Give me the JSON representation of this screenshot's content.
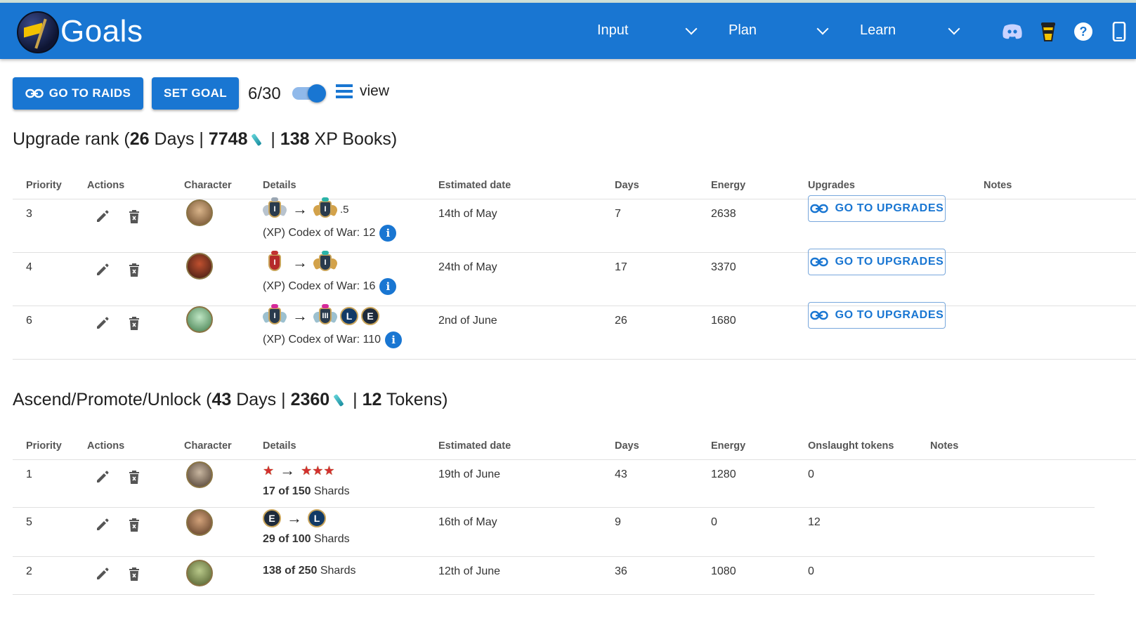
{
  "appbar": {
    "title": "Goals",
    "menus": [
      {
        "label": "Input"
      },
      {
        "label": "Plan"
      },
      {
        "label": "Learn"
      }
    ],
    "icons": [
      "discord-icon",
      "coffee-cup-icon",
      "help-icon",
      "mobile-icon"
    ]
  },
  "toolbar": {
    "raids_label": "GO TO RAIDS",
    "set_goal_label": "SET GOAL",
    "goal_count": "6/30",
    "view_label": "view",
    "view_toggle_on": true
  },
  "upgrade_section": {
    "prefix": "Upgrade rank (",
    "days": "26",
    "days_label": " Days | ",
    "energy": "7748",
    "sep": " | ",
    "books": "138",
    "books_label": " XP Books)",
    "columns": [
      "Priority",
      "Actions",
      "Character",
      "Details",
      "Estimated date",
      "Days",
      "Energy",
      "Upgrades",
      "Notes"
    ],
    "button_label": "GO TO UPGRADES",
    "rows": [
      {
        "priority": "3",
        "rank_suffix": ".5",
        "codex": "(XP) Codex of War: 12",
        "date": "14th of May",
        "days": "7",
        "energy": "2638"
      },
      {
        "priority": "4",
        "rank_suffix": "",
        "codex": "(XP) Codex of War: 16",
        "date": "24th of May",
        "days": "17",
        "energy": "3370"
      },
      {
        "priority": "6",
        "rank_suffix": "",
        "codex": "(XP) Codex of War: 110",
        "date": "2nd of June",
        "days": "26",
        "energy": "1680",
        "rarity_from": "L",
        "rarity_to": "E"
      }
    ]
  },
  "ascend_section": {
    "prefix": "Ascend/Promote/Unlock (",
    "days": "43",
    "days_label": " Days | ",
    "energy": "2360",
    "sep": " | ",
    "tokens": "12",
    "tokens_label": " Tokens)",
    "columns": [
      "Priority",
      "Actions",
      "Character",
      "Details",
      "Estimated date",
      "Days",
      "Energy",
      "Onslaught tokens",
      "Notes"
    ],
    "rows": [
      {
        "priority": "1",
        "shards_have": "17 of 150",
        "shards_label": " Shards",
        "date": "19th of June",
        "days": "43",
        "energy": "1280",
        "tokens": "0",
        "stars_from": 1,
        "stars_to": 3
      },
      {
        "priority": "5",
        "shards_have": "29 of 100",
        "shards_label": " Shards",
        "date": "16th of May",
        "days": "9",
        "energy": "0",
        "tokens": "12",
        "rarity_from": "E",
        "rarity_to": "L"
      },
      {
        "priority": "2",
        "shards_have": "138 of 250",
        "shards_label": " Shards",
        "date": "12th of June",
        "days": "36",
        "energy": "1080",
        "tokens": "0"
      }
    ]
  },
  "colors": {
    "primary": "#1976d2",
    "appbar": "#1976d2",
    "outline": "#78a7dc"
  }
}
